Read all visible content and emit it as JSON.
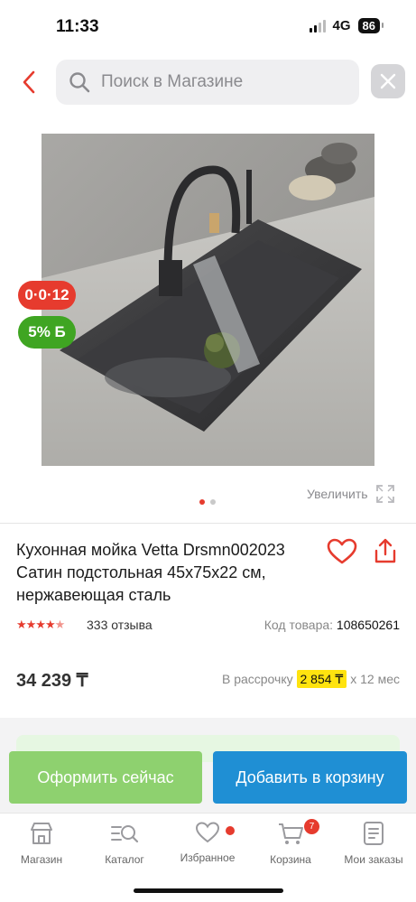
{
  "status_bar": {
    "time": "11:33",
    "network": "4G",
    "battery": "86"
  },
  "header": {
    "search_placeholder": "Поиск в Магазине"
  },
  "product": {
    "timer_badge": "0·0·12",
    "bonus_badge": "5% Б",
    "zoom_label": "Увеличить",
    "title_lines": [
      "Кухонная мойка Vetta Drsmn002023",
      "Сатин подстольная 45х75х22 см,",
      "нержавеющая сталь"
    ],
    "rating": 4.5,
    "reviews": "333 отзыва",
    "code_label": "Код товара:",
    "code_value": "108650261",
    "price": "34 239 ₸",
    "installment_prefix": "В рассрочку",
    "installment_amount": "2 854 ₸",
    "installment_suffix": "х 12 мес"
  },
  "gallery": {
    "total_slides": 2,
    "active_slide": 1
  },
  "actions": {
    "checkout": "Оформить сейчас",
    "add_to_cart": "Добавить в корзину"
  },
  "nav": {
    "items": [
      {
        "label": "Магазин",
        "icon": "shop-icon"
      },
      {
        "label": "Каталог",
        "icon": "catalog-icon"
      },
      {
        "label": "Избранное",
        "icon": "heart-icon"
      },
      {
        "label": "Корзина",
        "icon": "cart-icon",
        "badge": "7"
      },
      {
        "label": "Мои заказы",
        "icon": "orders-icon"
      }
    ]
  },
  "colors": {
    "accent_red": "#e63b2e",
    "green": "#8ed16f",
    "blue": "#1f8fd4",
    "bonus_green": "#3fa522",
    "highlight": "#ffe30f"
  }
}
